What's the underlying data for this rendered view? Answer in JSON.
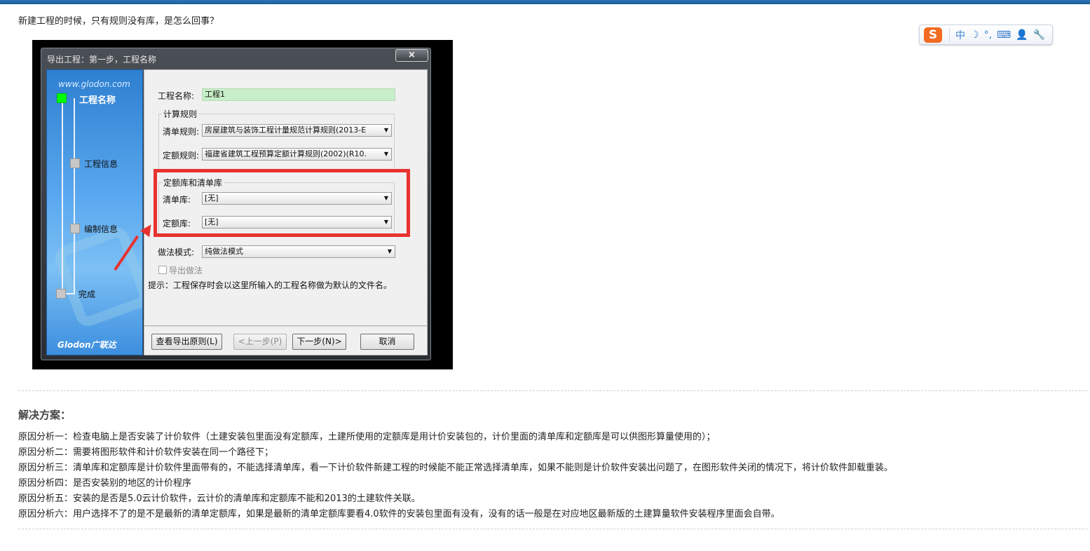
{
  "question": "新建工程的时候，只有规则没有库，是怎么回事？",
  "ime": {
    "logo": "S",
    "glyphs": [
      "中",
      "☽",
      "°,",
      "⌨",
      "👤",
      "🔧"
    ]
  },
  "dialog": {
    "title": "导出工程：第一步，工程名称",
    "close_label": "×",
    "side_url": "www.glodon.com",
    "brand": "Glodon广联达",
    "steps": [
      "工程名称",
      "工程信息",
      "编制信息",
      "完成"
    ],
    "project_name_label": "工程名称:",
    "project_name_value": "工程1",
    "calc_rules_group": "计算规则",
    "list_rule_label": "清单规则:",
    "list_rule_value": "房屋建筑与装饰工程计量规范计算规则(2013-E",
    "quota_rule_label": "定额规则:",
    "quota_rule_value": "福建省建筑工程预算定额计算规则(2002)(R10.",
    "lib_group": "定额库和清单库",
    "list_lib_label": "清单库:",
    "list_lib_value": "[无]",
    "quota_lib_label": "定额库:",
    "quota_lib_value": "[无]",
    "method_label": "做法模式:",
    "method_value": "纯做法模式",
    "export_method_label": "导出做法",
    "hint": "提示：工程保存时会以这里所输入的工程名称做为默认的文件名。",
    "buttons": {
      "view_rules": "查看导出原则(L)",
      "prev": "<上一步(P)",
      "next": "下一步(N)>",
      "cancel": "取消"
    }
  },
  "solution_title": "解决方案：",
  "answers": [
    "原因分析一：检查电脑上是否安装了计价软件（土建安装包里面没有定额库，土建所使用的定额库是用计价安装包的，计价里面的清单库和定额库是可以供图形算量使用的）；",
    "原因分析二：需要将图形软件和计价软件安装在同一个路径下；",
    "原因分析三：清单库和定额库是计价软件里面带有的，不能选择清单库，看一下计价软件新建工程的时候能不能正常选择清单库，如果不能则是计价软件安装出问题了，在图形软件关闭的情况下，将计价软件卸载重装。",
    "原因分析四：是否安装别的地区的计价程序",
    "原因分析五：安装的是否是5.0云计价软件，云计价的清单库和定额库不能和2013的土建软件关联。",
    "原因分析六：用户选择不了的是不是最新的清单定额库，如果是最新的清单定额库要看4.0软件的安装包里面有没有，没有的话一般是在对应地区最新版的土建算量软件安装程序里面会自带。"
  ]
}
